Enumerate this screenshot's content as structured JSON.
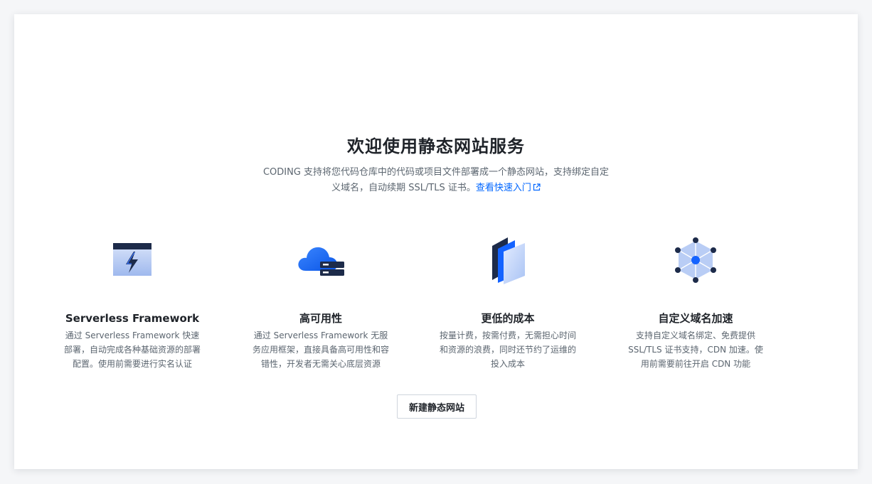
{
  "welcome": {
    "title": "欢迎使用静态网站服务",
    "description": "CODING 支持将您代码仓库中的代码或项目文件部署成一个静态网站，支持绑定自定义域名，自动续期 SSL/TLS 证书。",
    "link_label": "查看快速入门"
  },
  "features": [
    {
      "icon": "serverless-framework-icon",
      "title": "Serverless Framework",
      "text": "通过 Serverless Framework 快速部署，自动完成各种基础资源的部署配置。使用前需要进行实名认证"
    },
    {
      "icon": "cloud-server-icon",
      "title": "高可用性",
      "text": "通过 Serverless Framework 无服务应用框架，直接具备高可用性和容错性，开发者无需关心底层资源"
    },
    {
      "icon": "cost-layers-icon",
      "title": "更低的成本",
      "text": "按量计费，按需付费，无需担心时间和资源的浪费，同时还节约了运维的投入成本"
    },
    {
      "icon": "domain-network-icon",
      "title": "自定义域名加速",
      "text": "支持自定义域名绑定、免费提供 SSL/TLS 证书支持，CDN 加速。使用前需要前往开启 CDN 功能"
    }
  ],
  "actions": {
    "create_label": "新建静态网站"
  },
  "colors": {
    "accent": "#0066ff",
    "title": "#1f2329",
    "text": "#5c6670"
  }
}
